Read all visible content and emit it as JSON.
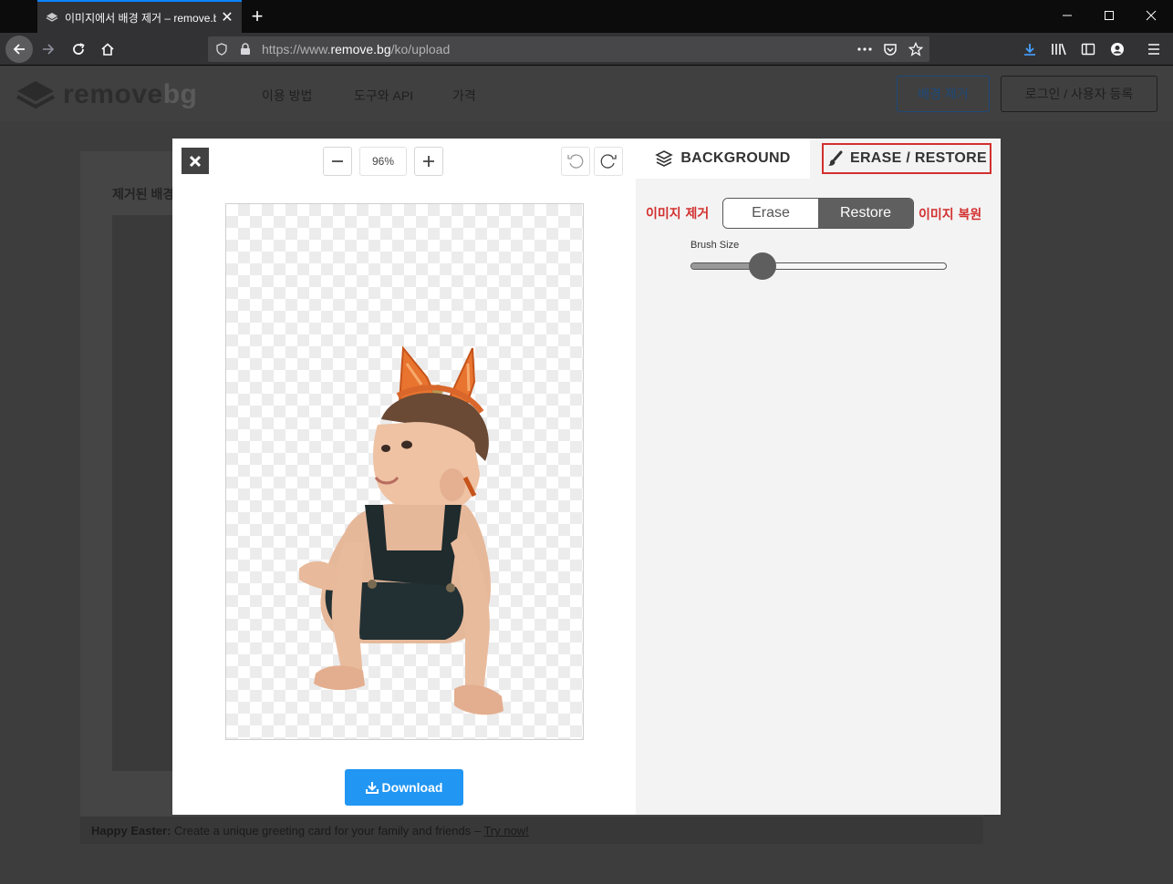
{
  "browser": {
    "tab_title": "이미지에서 배경 제거 – remove.bg",
    "url_prefix": "https://www.",
    "url_domain": "remove.bg",
    "url_path": "/ko/upload"
  },
  "site": {
    "logo_primary": "remove",
    "logo_secondary": "bg",
    "nav": [
      "이용 방법",
      "도구와 API",
      "가격"
    ],
    "primary_button": "배경 제거",
    "login_button": "로그인 / 사용자 등록",
    "card_title": "제거된 배경",
    "banner_bold": "Happy Easter:",
    "banner_text": " Create a unique greeting card for your family and friends – ",
    "banner_link": "Try now!"
  },
  "editor": {
    "zoom": "96%",
    "download_label": "Download",
    "tab_background": "BACKGROUND",
    "tab_erase_restore": "ERASE / RESTORE",
    "annotation_erase": "이미지 제거",
    "annotation_restore": "이미지 복원",
    "mode_erase": "Erase",
    "mode_restore": "Restore",
    "active_mode": "Restore",
    "brush_size_label": "Brush Size",
    "brush_size_fraction": 0.28
  },
  "colors": {
    "accent_blue": "#2196f3",
    "highlight_red": "#d32f2f",
    "firefox_blue": "#0a84ff"
  },
  "icons": [
    "layers-icon",
    "brush-icon",
    "close-icon",
    "minus-icon",
    "plus-icon",
    "undo-icon",
    "redo-icon",
    "download-icon"
  ]
}
